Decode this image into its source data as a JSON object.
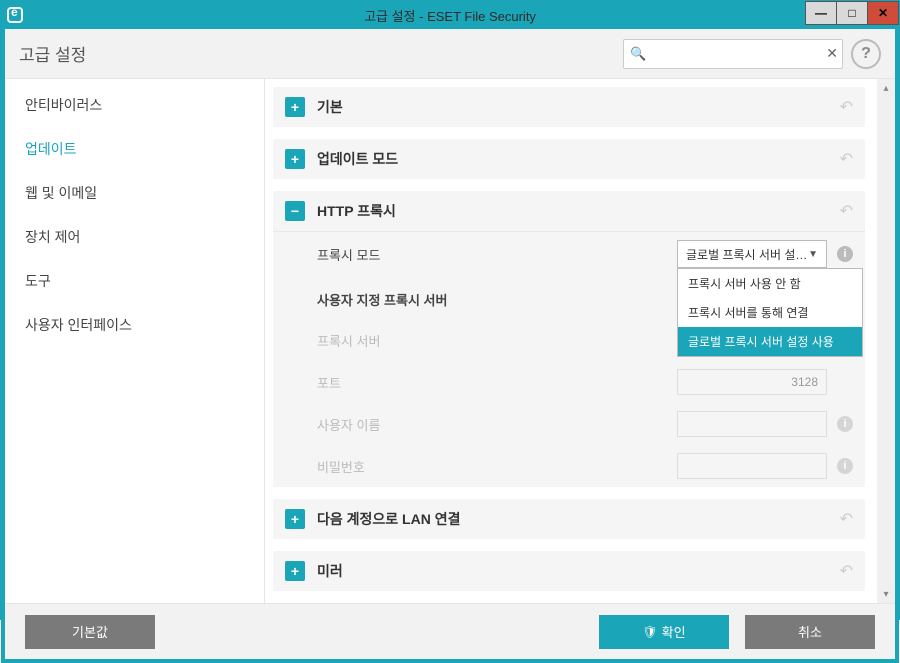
{
  "window_title": "고급 설정 - ESET File Security",
  "header": {
    "title": "고급 설정",
    "search_placeholder": ""
  },
  "sidebar": {
    "items": [
      {
        "label": "안티바이러스"
      },
      {
        "label": "업데이트"
      },
      {
        "label": "웹 및 이메일"
      },
      {
        "label": "장치 제어"
      },
      {
        "label": "도구"
      },
      {
        "label": "사용자 인터페이스"
      }
    ],
    "selected_index": 1
  },
  "panels": {
    "basic": {
      "title": "기본"
    },
    "update_mode": {
      "title": "업데이트 모드"
    },
    "http_proxy": {
      "title": "HTTP 프록시",
      "proxy_mode_label": "프록시 모드",
      "proxy_mode_selected": "글로벌 프록시 서버 설정...",
      "proxy_mode_options": [
        "프록시 서버 사용 안 함",
        "프록시 서버를 통해 연결",
        "글로벌 프록시 서버 설정 사용"
      ],
      "custom_server_header": "사용자 지정 프록시 서버",
      "server_label": "프록시 서버",
      "server_value": "",
      "port_label": "포트",
      "port_value": "3128",
      "username_label": "사용자 이름",
      "username_value": "",
      "password_label": "비밀번호",
      "password_value": ""
    },
    "lan": {
      "title": "다음 계정으로 LAN 연결"
    },
    "mirror": {
      "title": "미러"
    }
  },
  "footer": {
    "default": "기본값",
    "ok": "확인",
    "cancel": "취소"
  }
}
